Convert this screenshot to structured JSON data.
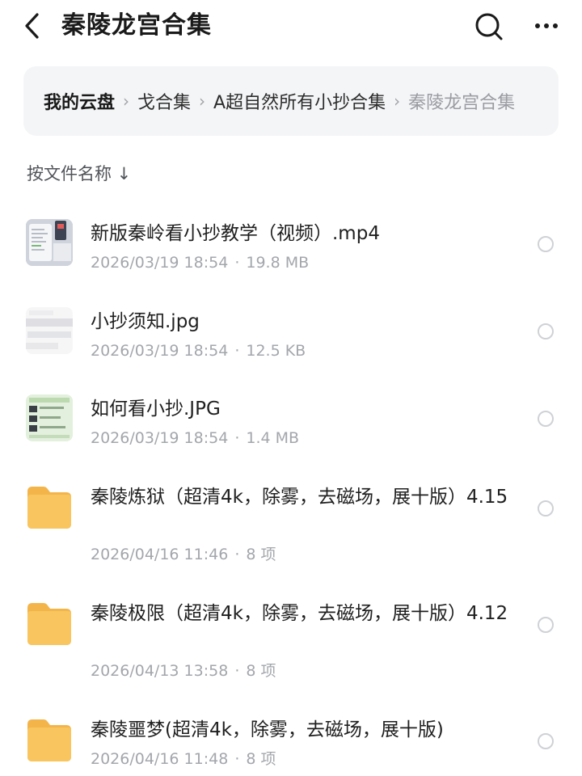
{
  "header": {
    "title": "秦陵龙宫合集",
    "back_icon": "chevron-left-icon",
    "search_icon": "search-icon",
    "more_icon": "more-horizontal-icon"
  },
  "breadcrumb": {
    "root": "我的云盘",
    "items": [
      "⁠​戈合集",
      "A超自然所有小抄合集"
    ],
    "current": "秦陵龙宫合集"
  },
  "sort": {
    "label": "按文件名称 ↓"
  },
  "files": [
    {
      "name": "新版秦岭看小抄教学（视频）.mp4",
      "date": "2026/03/19 18:54",
      "size": "19.8 MB",
      "kind": "video"
    },
    {
      "name": "小抄须知.jpg",
      "date": "2026/03/19 18:54",
      "size": "12.5 KB",
      "kind": "image"
    },
    {
      "name": "如何看小抄.JPG",
      "date": "2026/03/19 18:54",
      "size": "1.4 MB",
      "kind": "image"
    },
    {
      "name": "秦陵炼狱（超清4k，除雾，去磁场，展十版）4.15",
      "date": "2026/04/16 11:46",
      "size": "8 项",
      "kind": "folder"
    },
    {
      "name": "秦陵极限（超清4k，除雾，去磁场，展十版）4.12",
      "date": "2026/04/13 13:58",
      "size": "8 项",
      "kind": "folder"
    },
    {
      "name": "秦陵噩梦(超清4k，除雾，去磁场，展十版)",
      "date": "2026/04/16 11:48",
      "size": "8 项",
      "kind": "folder"
    }
  ],
  "colors": {
    "folder": "#f8c55e",
    "folder_back": "#f3b54a",
    "meta_text": "#a3a6ab",
    "breadcrumb_bg": "#f4f5f7",
    "radio_border": "#cfd1d5"
  }
}
